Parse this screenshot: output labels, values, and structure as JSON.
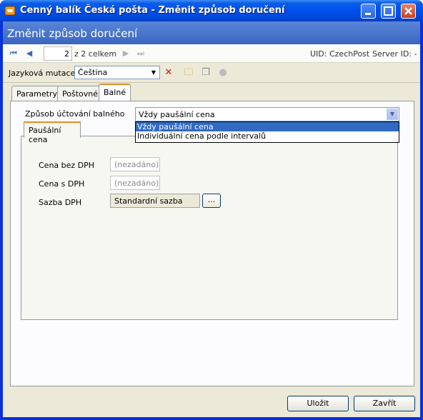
{
  "window": {
    "title": "Cenný balík Česká pošta - Změnit způsob doručení"
  },
  "form": {
    "title": "Změnit způsob doručení"
  },
  "navigation": {
    "page": "2",
    "total": "z 2 celkem",
    "uid": "UID: CzechPost",
    "server": "Server ID: -"
  },
  "language": {
    "label": "Jazyková mutace",
    "value": "Čeština"
  },
  "tabs": [
    {
      "label": "Parametry"
    },
    {
      "label": "Poštovné"
    },
    {
      "label": "Balné"
    }
  ],
  "balne": {
    "billing_label": "Způsob účtování balného",
    "billing_value": "Vždy paušální cena",
    "options": [
      "Vždy paušální cena",
      "Individuální cena podle intervalů"
    ],
    "subtab": "Paušální cena",
    "fields": {
      "price_no_vat_label": "Cena bez DPH",
      "price_no_vat_value": "(nezadáno)",
      "price_vat_label": "Cena s DPH",
      "price_vat_value": "(nezadáno)",
      "vat_rate_label": "Sazba DPH",
      "vat_rate_value": "Standardní sazba",
      "browse": "..."
    }
  },
  "buttons": {
    "save": "Uložit",
    "close": "Zavřít"
  }
}
